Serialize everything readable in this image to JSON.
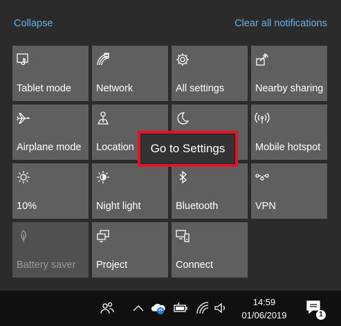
{
  "header": {
    "collapse_label": "Collapse",
    "clear_all_label": "Clear all notifications"
  },
  "tiles": [
    {
      "label": "Tablet mode",
      "icon": "tablet-mode-icon",
      "enabled": true
    },
    {
      "label": "Network",
      "icon": "network-icon",
      "enabled": true
    },
    {
      "label": "All settings",
      "icon": "settings-gear-icon",
      "enabled": true
    },
    {
      "label": "Nearby sharing",
      "icon": "nearby-sharing-icon",
      "enabled": true
    },
    {
      "label": "Airplane mode",
      "icon": "airplane-icon",
      "enabled": true
    },
    {
      "label": "Location",
      "icon": "location-icon",
      "enabled": true
    },
    {
      "label": "",
      "icon": "moon-icon",
      "enabled": true
    },
    {
      "label": "Mobile hotspot",
      "icon": "mobile-hotspot-icon",
      "enabled": true
    },
    {
      "label": "10%",
      "icon": "brightness-icon",
      "enabled": true
    },
    {
      "label": "Night light",
      "icon": "night-light-icon",
      "enabled": true
    },
    {
      "label": "Bluetooth",
      "icon": "bluetooth-icon",
      "enabled": true
    },
    {
      "label": "VPN",
      "icon": "vpn-icon",
      "enabled": true
    },
    {
      "label": "Battery saver",
      "icon": "battery-saver-icon",
      "enabled": false
    },
    {
      "label": "Project",
      "icon": "project-icon",
      "enabled": true
    },
    {
      "label": "Connect",
      "icon": "connect-icon",
      "enabled": true
    }
  ],
  "tooltip": {
    "text": "Go to Settings"
  },
  "taskbar": {
    "time": "14:59",
    "date": "01/06/2019",
    "notification_count": "1",
    "icons": [
      "people-icon",
      "chevron-up-icon",
      "onedrive-sync-icon",
      "battery-icon",
      "wifi-icon",
      "volume-icon"
    ]
  },
  "colors": {
    "accent_link": "#6ab1e7",
    "tile": "#5f5f5f",
    "highlight_border": "#e81123"
  }
}
